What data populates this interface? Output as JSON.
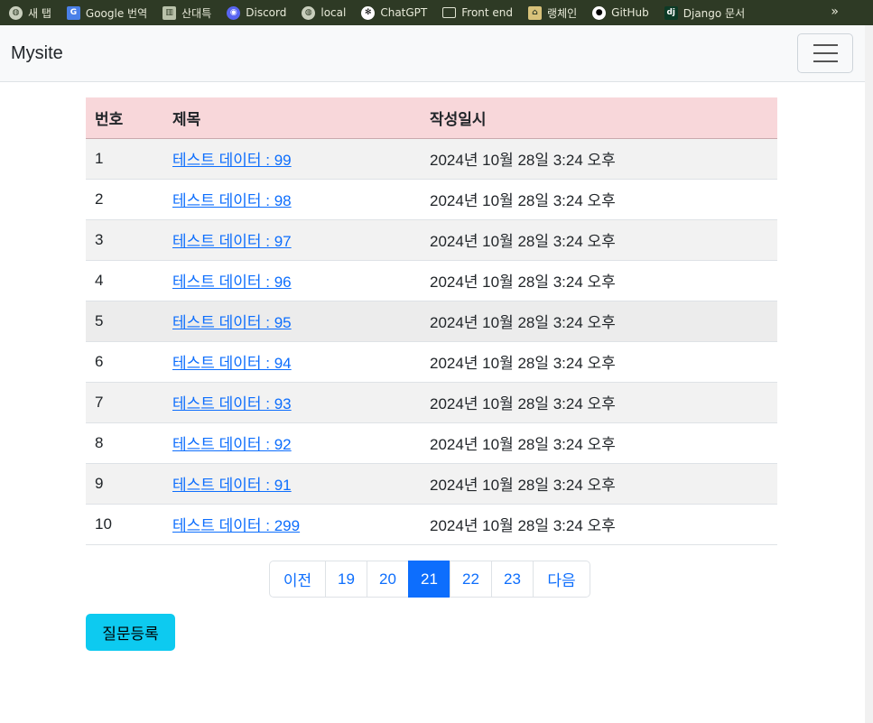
{
  "bookmarks": [
    {
      "label": "새 탭",
      "icon": "globe-icon"
    },
    {
      "label": "Google 번역",
      "icon": "google-translate-icon"
    },
    {
      "label": "산대특",
      "icon": "sheet-icon"
    },
    {
      "label": "Discord",
      "icon": "discord-icon"
    },
    {
      "label": "local",
      "icon": "globe-icon"
    },
    {
      "label": "ChatGPT",
      "icon": "chatgpt-icon"
    },
    {
      "label": "Front end",
      "icon": "folder-icon"
    },
    {
      "label": "랭체인",
      "icon": "house-icon"
    },
    {
      "label": "GitHub",
      "icon": "github-icon"
    },
    {
      "label": "Django 문서",
      "icon": "django-icon"
    }
  ],
  "bookmarks_more": "»",
  "navbar": {
    "brand": "Mysite"
  },
  "table": {
    "headers": [
      "번호",
      "제목",
      "작성일시"
    ],
    "rows": [
      {
        "num": "1",
        "title": "테스트 데이터 : 99",
        "date": "2024년 10월 28일 3:24 오후"
      },
      {
        "num": "2",
        "title": "테스트 데이터 : 98",
        "date": "2024년 10월 28일 3:24 오후"
      },
      {
        "num": "3",
        "title": "테스트 데이터 : 97",
        "date": "2024년 10월 28일 3:24 오후"
      },
      {
        "num": "4",
        "title": "테스트 데이터 : 96",
        "date": "2024년 10월 28일 3:24 오후"
      },
      {
        "num": "5",
        "title": "테스트 데이터 : 95",
        "date": "2024년 10월 28일 3:24 오후"
      },
      {
        "num": "6",
        "title": "테스트 데이터 : 94",
        "date": "2024년 10월 28일 3:24 오후"
      },
      {
        "num": "7",
        "title": "테스트 데이터 : 93",
        "date": "2024년 10월 28일 3:24 오후"
      },
      {
        "num": "8",
        "title": "테스트 데이터 : 92",
        "date": "2024년 10월 28일 3:24 오후"
      },
      {
        "num": "9",
        "title": "테스트 데이터 : 91",
        "date": "2024년 10월 28일 3:24 오후"
      },
      {
        "num": "10",
        "title": "테스트 데이터 : 299",
        "date": "2024년 10월 28일 3:24 오후"
      }
    ]
  },
  "pagination": {
    "prev": "이전",
    "pages": [
      "19",
      "20",
      "21",
      "22",
      "23"
    ],
    "active": "21",
    "next": "다음"
  },
  "ask_button": "질문등록",
  "colors": {
    "header_bg": "#f8d7da",
    "link": "#0d6efd",
    "active_page": "#0d6efd",
    "ask_button": "#0dcaf0"
  }
}
